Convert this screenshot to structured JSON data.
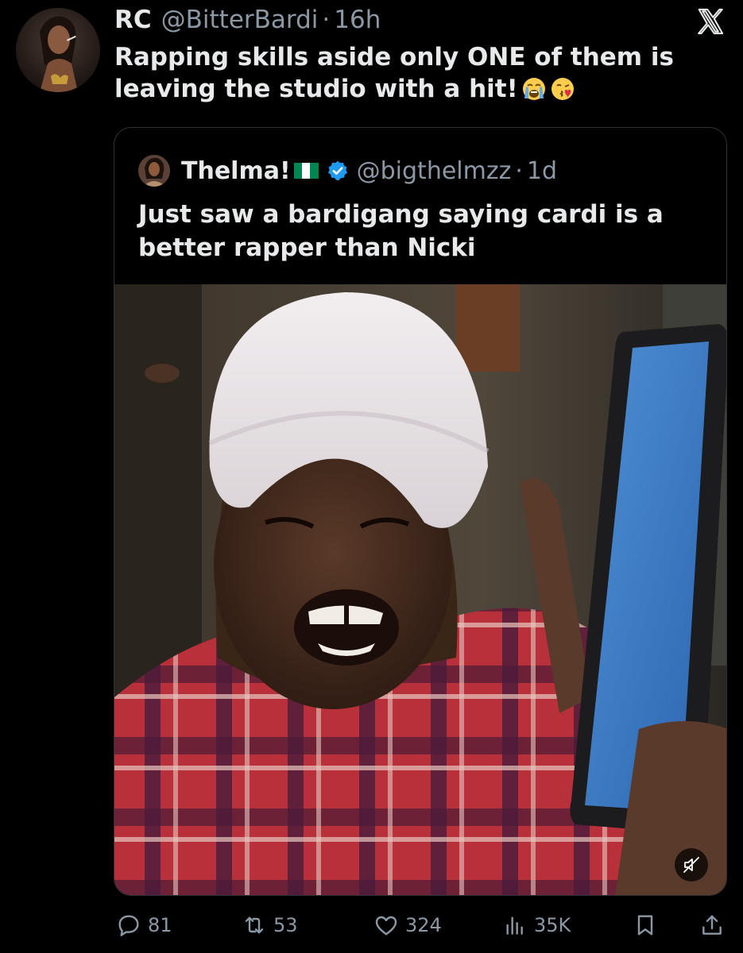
{
  "tweet": {
    "display_name": "RC",
    "handle": "@BitterBardi",
    "separator": "·",
    "time": "16h",
    "text": "Rapping skills aside only ONE of them is leaving the studio with a hit!",
    "emojis": [
      "loudly-crying-face",
      "face-blowing-a-kiss"
    ]
  },
  "quote": {
    "display_name": "Thelma!",
    "flag": "nigeria-flag",
    "verified": true,
    "handle": "@bigthelmzz",
    "separator": "·",
    "time": "1d",
    "text": "Just saw a bardigang saying cardi is a better rapper than Nicki",
    "media": {
      "type": "video",
      "muted": true
    }
  },
  "actions": {
    "replies": "81",
    "reposts": "53",
    "likes": "324",
    "views": "35K"
  },
  "colors": {
    "background": "#000000",
    "primary_text": "#e7e9ea",
    "secondary_text": "#8b98a5",
    "border": "#2f3336",
    "verified_badge": "#1d9bf0",
    "flag_green": "#008751"
  },
  "icons": [
    "x-logo-icon",
    "verified-badge-icon",
    "mute-icon",
    "reply-icon",
    "repost-icon",
    "like-icon",
    "views-icon",
    "bookmark-icon",
    "share-icon"
  ]
}
